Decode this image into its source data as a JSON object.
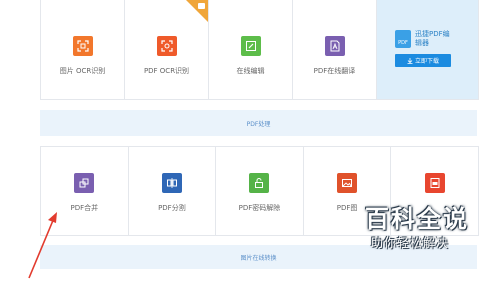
{
  "row1": {
    "tiles": [
      {
        "label": "图片 OCR识别",
        "icon": "image-ocr-icon",
        "color": "#f2772c"
      },
      {
        "label": "PDF OCR识别",
        "icon": "pdf-ocr-icon",
        "color": "#ef5a2a"
      },
      {
        "label": "在线编辑",
        "icon": "edit-icon",
        "color": "#5dbd4a"
      },
      {
        "label": "PDF在线翻译",
        "icon": "translate-icon",
        "color": "#7a5fb0"
      }
    ],
    "promo": {
      "logo_text": "PDF",
      "title": "迅捷PDF编辑器",
      "button_label": "立即下载",
      "color": "#1b8be0"
    }
  },
  "band1": {
    "label": "PDF处理"
  },
  "row2": {
    "tiles": [
      {
        "label": "PDF合并",
        "icon": "merge-icon",
        "color": "#7a5fb0"
      },
      {
        "label": "PDF分割",
        "icon": "split-icon",
        "color": "#2f67b6"
      },
      {
        "label": "PDF密码解除",
        "icon": "unlock-icon",
        "color": "#55b348"
      },
      {
        "label": "PDF图",
        "icon": "pdf-image-icon",
        "color": "#e0522b"
      },
      {
        "label": "",
        "icon": "pdf-to-file-icon",
        "color": "#e8462f"
      }
    ]
  },
  "band2": {
    "label": "图片在线转换"
  },
  "watermark": {
    "title": "百科全说",
    "subtitle": "助你轻松解决"
  }
}
